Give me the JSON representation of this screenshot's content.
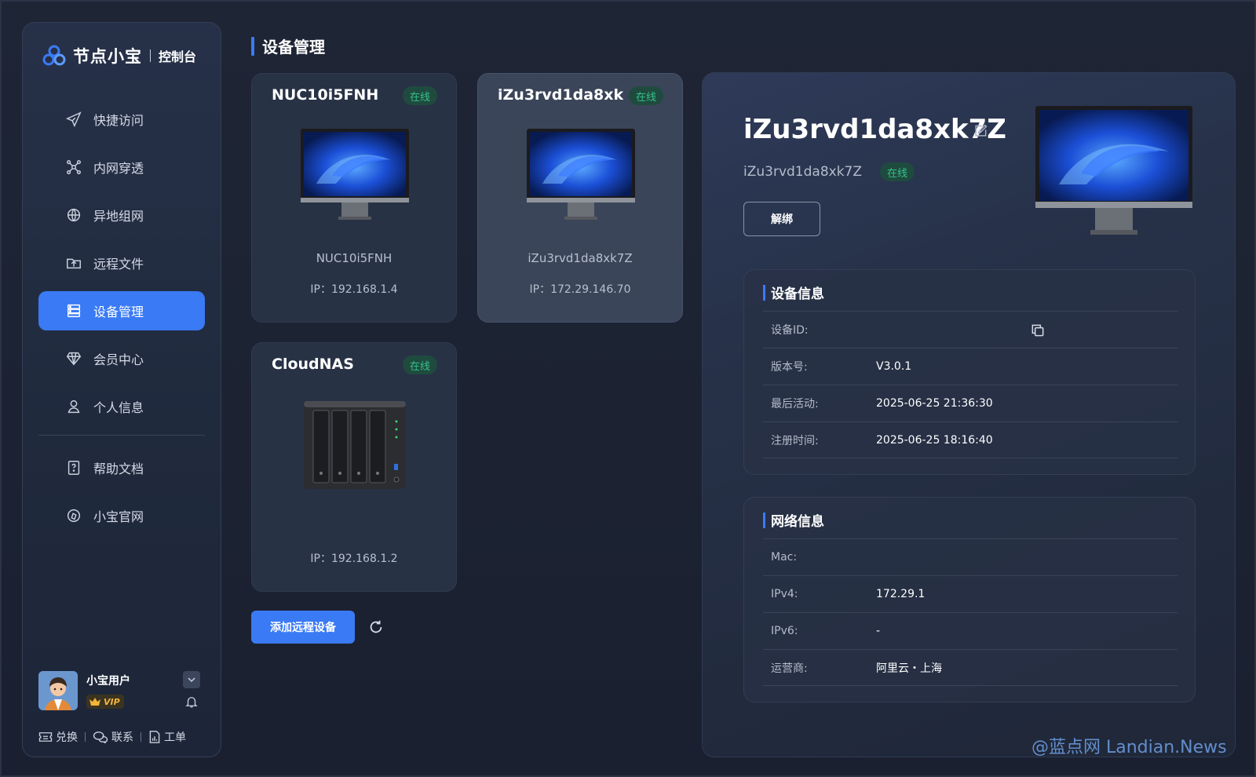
{
  "app": {
    "name": "节点小宝",
    "subtitle": "控制台"
  },
  "sidebar": {
    "items": [
      {
        "label": "快捷访问",
        "icon": "send-icon"
      },
      {
        "label": "内网穿透",
        "icon": "network-icon"
      },
      {
        "label": "异地组网",
        "icon": "globe-icon"
      },
      {
        "label": "远程文件",
        "icon": "folder-upload-icon"
      },
      {
        "label": "设备管理",
        "icon": "server-icon",
        "active": true
      },
      {
        "label": "会员中心",
        "icon": "diamond-icon"
      },
      {
        "label": "个人信息",
        "icon": "user-icon"
      },
      {
        "label": "帮助文档",
        "icon": "help-doc-icon"
      },
      {
        "label": "小宝官网",
        "icon": "compass-icon"
      }
    ],
    "user": {
      "name": "小宝用户",
      "badge": "VIP"
    },
    "footer": [
      {
        "label": "兑换",
        "icon": "ticket-icon"
      },
      {
        "label": "联系",
        "icon": "chat-icon"
      },
      {
        "label": "工单",
        "icon": "report-icon"
      }
    ]
  },
  "main": {
    "title": "设备管理",
    "devices": [
      {
        "name": "NUC10i5FNH",
        "status": "在线",
        "subname": "NUC10i5FNH",
        "ip": "IP：192.168.1.4",
        "type": "monitor"
      },
      {
        "name": "iZu3rvd1da8xk···",
        "status": "在线",
        "subname": "iZu3rvd1da8xk7Z",
        "ip": "IP：172.29.146.70",
        "type": "monitor",
        "selected": true
      },
      {
        "name": "CloudNAS",
        "status": "在线",
        "subname": "",
        "ip": "IP：192.168.1.2",
        "type": "nas"
      }
    ],
    "add_button": "添加远程设备"
  },
  "detail": {
    "title": "iZu3rvd1da8xk7Z",
    "subtitle": "iZu3rvd1da8xk7Z",
    "status": "在线",
    "unbind": "解绑",
    "device_info": {
      "title": "设备信息",
      "rows": [
        {
          "label": "设备ID:",
          "value": ""
        },
        {
          "label": "版本号:",
          "value": "V3.0.1"
        },
        {
          "label": "最后活动:",
          "value": "2025-06-25 21:36:30"
        },
        {
          "label": "注册时间:",
          "value": "2025-06-25 18:16:40"
        }
      ]
    },
    "network_info": {
      "title": "网络信息",
      "rows": [
        {
          "label": "Mac:",
          "value": ""
        },
        {
          "label": "IPv4:",
          "value": "172.29.1"
        },
        {
          "label": "IPv6:",
          "value": "-"
        },
        {
          "label": "运营商:",
          "value": "阿里云・上海"
        }
      ]
    }
  },
  "watermark": "@蓝点网 Landian.News",
  "colors": {
    "accent": "#3a7af4",
    "online_text": "#36c08a",
    "online_bg": "#1f4b3f"
  }
}
